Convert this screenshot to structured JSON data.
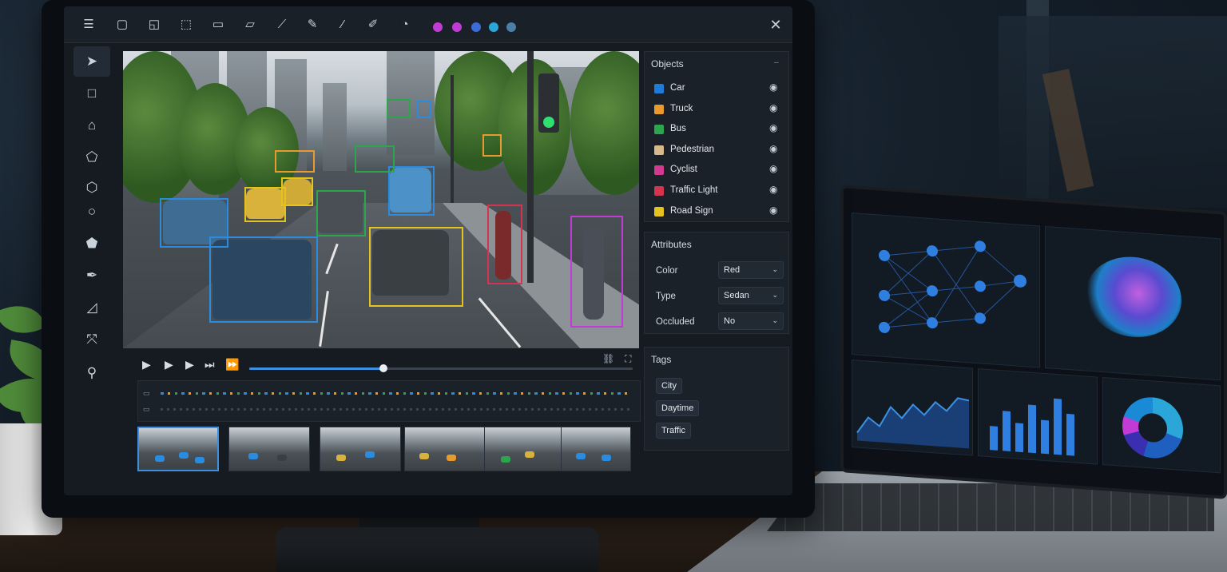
{
  "toolbar": {
    "tools": [
      "tree-tool-icon",
      "bbox-tool-icon",
      "polygon-tool-icon",
      "cuboid-tool-icon",
      "rect-tool-icon",
      "shape-tool-icon",
      "line-tool-icon",
      "pen-tool-icon",
      "brush-tool-icon",
      "pencil-tool-icon",
      "tag-tool-icon"
    ],
    "colors": [
      "#c23bd4",
      "#c23bd4",
      "#3d6bd6",
      "#2aa6d8",
      "#4a7fa8"
    ],
    "close_glyph": "✕"
  },
  "left_tools": [
    "select-tool",
    "rectangle-tool",
    "polygon-tool",
    "pentagon-tool",
    "hexagon-tool",
    "circle-tool",
    "freeform-tool",
    "pen-tool",
    "measure-tool",
    "keypoint-tool",
    "magic-tool"
  ],
  "objects": {
    "title": "Objects",
    "items": [
      {
        "label": "Car",
        "color": "#1f7bd9"
      },
      {
        "label": "Truck",
        "color": "#e79b2e"
      },
      {
        "label": "Bus",
        "color": "#2da44e"
      },
      {
        "label": "Pedestrian",
        "color": "#d8b98a"
      },
      {
        "label": "Cyclist",
        "color": "#d23a8f"
      },
      {
        "label": "Traffic Light",
        "color": "#d4344e"
      },
      {
        "label": "Road Sign",
        "color": "#e6c21d"
      }
    ]
  },
  "attributes": {
    "title": "Attributes",
    "items": [
      {
        "label": "Color",
        "value": "Red"
      },
      {
        "label": "Type",
        "value": "Sedan"
      },
      {
        "label": "Occluded",
        "value": "No"
      }
    ]
  },
  "tags": {
    "title": "Tags",
    "items": [
      "City",
      "Daytime",
      "Traffic"
    ]
  },
  "playback": {
    "progress": 0.35
  }
}
